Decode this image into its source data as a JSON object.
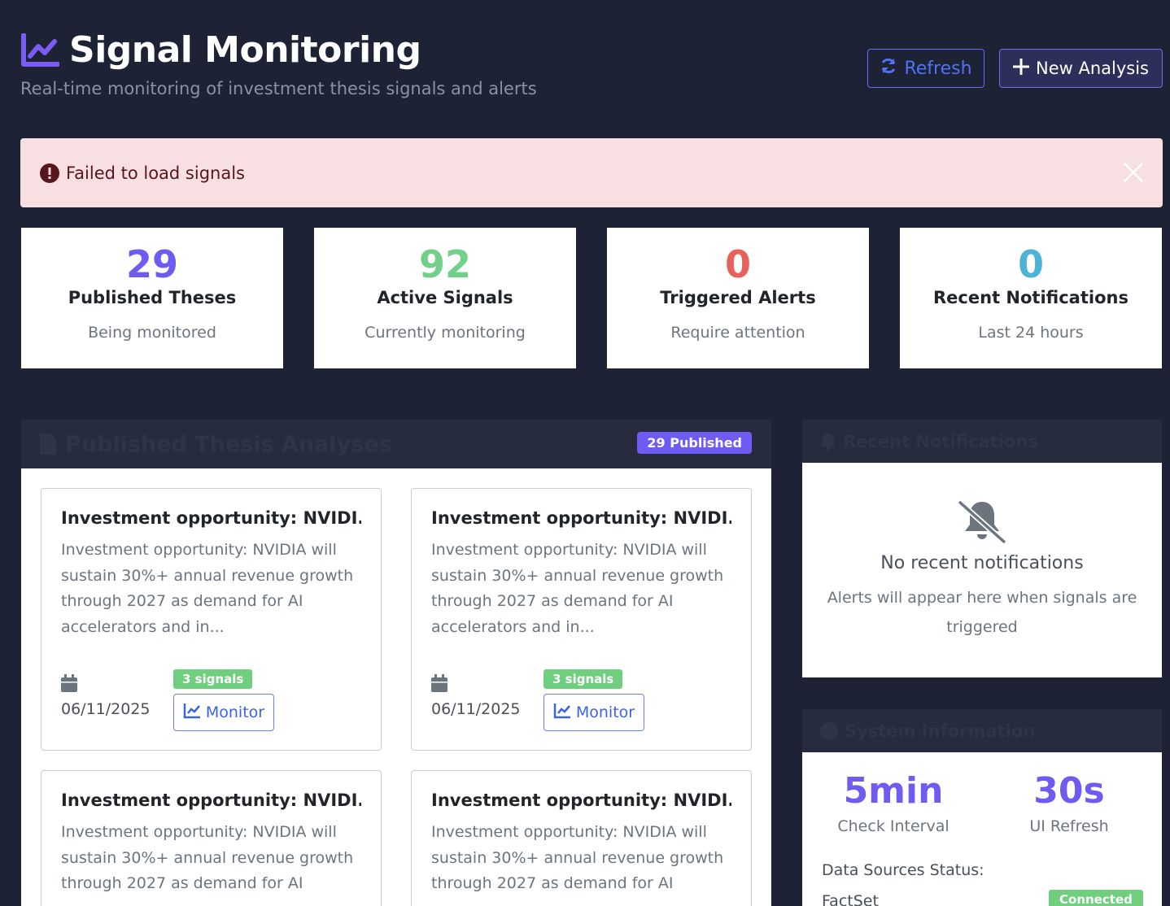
{
  "header": {
    "title": "Signal Monitoring",
    "subtitle": "Real-time monitoring of investment thesis signals and alerts",
    "refresh_label": "Refresh",
    "new_analysis_label": "New Analysis"
  },
  "alert": {
    "message": "Failed to load signals"
  },
  "stats": [
    {
      "value": "29",
      "label": "Published Theses",
      "sub": "Being monitored",
      "color": "#6e5cf2"
    },
    {
      "value": "92",
      "label": "Active Signals",
      "sub": "Currently monitoring",
      "color": "#72d08a"
    },
    {
      "value": "0",
      "label": "Triggered Alerts",
      "sub": "Require attention",
      "color": "#e8615a"
    },
    {
      "value": "0",
      "label": "Recent Notifications",
      "sub": "Last 24 hours",
      "color": "#4bb3d4"
    }
  ],
  "theses_panel": {
    "title": "Published Thesis Analyses",
    "badge": "29 Published",
    "cards": [
      {
        "title": "Investment opportunity: NVIDI...",
        "description": "Investment opportunity: NVIDIA will sustain 30%+ annual revenue growth through 2027 as demand for AI accelerators and in...",
        "date": "06/11/2025",
        "signals": "3 signals",
        "monitor_label": "Monitor"
      },
      {
        "title": "Investment opportunity: NVIDI...",
        "description": "Investment opportunity: NVIDIA will sustain 30%+ annual revenue growth through 2027 as demand for AI accelerators and in...",
        "date": "06/11/2025",
        "signals": "3 signals",
        "monitor_label": "Monitor"
      },
      {
        "title": "Investment opportunity: NVIDI...",
        "description": "Investment opportunity: NVIDIA will sustain 30%+ annual revenue growth through 2027 as demand for AI"
      },
      {
        "title": "Investment opportunity: NVIDI...",
        "description": "Investment opportunity: NVIDIA will sustain 30%+ annual revenue growth through 2027 as demand for AI"
      }
    ]
  },
  "notifications_panel": {
    "title": "Recent Notifications",
    "empty_title": "No recent notifications",
    "empty_sub": "Alerts will appear here when signals are triggered"
  },
  "system_panel": {
    "title": "System Information",
    "check_interval_value": "5min",
    "check_interval_label": "Check Interval",
    "ui_refresh_value": "30s",
    "ui_refresh_label": "UI Refresh",
    "data_sources_label": "Data Sources Status:",
    "source_name": "FactSet",
    "source_status": "Connected"
  }
}
